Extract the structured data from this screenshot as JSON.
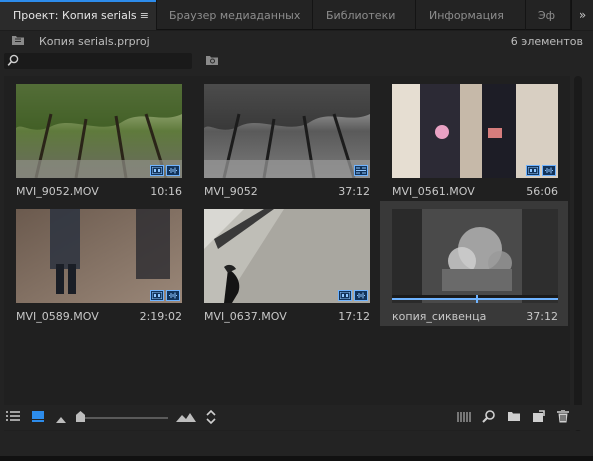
{
  "tabs": [
    {
      "label": "Проект: Копия serials",
      "active": true
    },
    {
      "label": "Браузер медиаданных",
      "active": false
    },
    {
      "label": "Библиотеки",
      "active": false
    },
    {
      "label": "Информация",
      "active": false
    },
    {
      "label": "Эф",
      "active": false
    }
  ],
  "tab_menu_glyph": "≡",
  "overflow_glyph": "»",
  "project": {
    "path": "Копия serials.prproj",
    "item_count": "6 элементов"
  },
  "search": {
    "placeholder": "",
    "value": ""
  },
  "clips": [
    {
      "name": "MVI_9052.MOV",
      "duration": "10:16",
      "selected": false
    },
    {
      "name": "MVI_9052",
      "duration": "37:12",
      "selected": false
    },
    {
      "name": "MVI_0561.MOV",
      "duration": "56:06",
      "selected": false
    },
    {
      "name": "MVI_0589.MOV",
      "duration": "2:19:02",
      "selected": false
    },
    {
      "name": "MVI_0637.MOV",
      "duration": "17:12",
      "selected": false
    },
    {
      "name": "копия_сиквенца",
      "duration": "37:12",
      "selected": true
    }
  ],
  "icons": {
    "bin": "folder-bin-icon",
    "search": "search-icon",
    "new_bin": "new-bin-icon",
    "list_view": "list-view-icon",
    "icon_view": "icon-view-icon",
    "freeform": "freeform-view-icon",
    "zoom_out": "zoom-out-icon",
    "zoom_in": "zoom-in-icon",
    "sort": "sort-icons-icon",
    "automate": "automate-to-sequence-icon",
    "find": "find-icon",
    "new_folder": "new-bin-icon",
    "new_item": "new-item-icon",
    "clear": "trash-icon"
  },
  "colors": {
    "accent": "#2d8ceb",
    "badge_border": "#6fb3ff",
    "badge_fill": "#12335a"
  }
}
